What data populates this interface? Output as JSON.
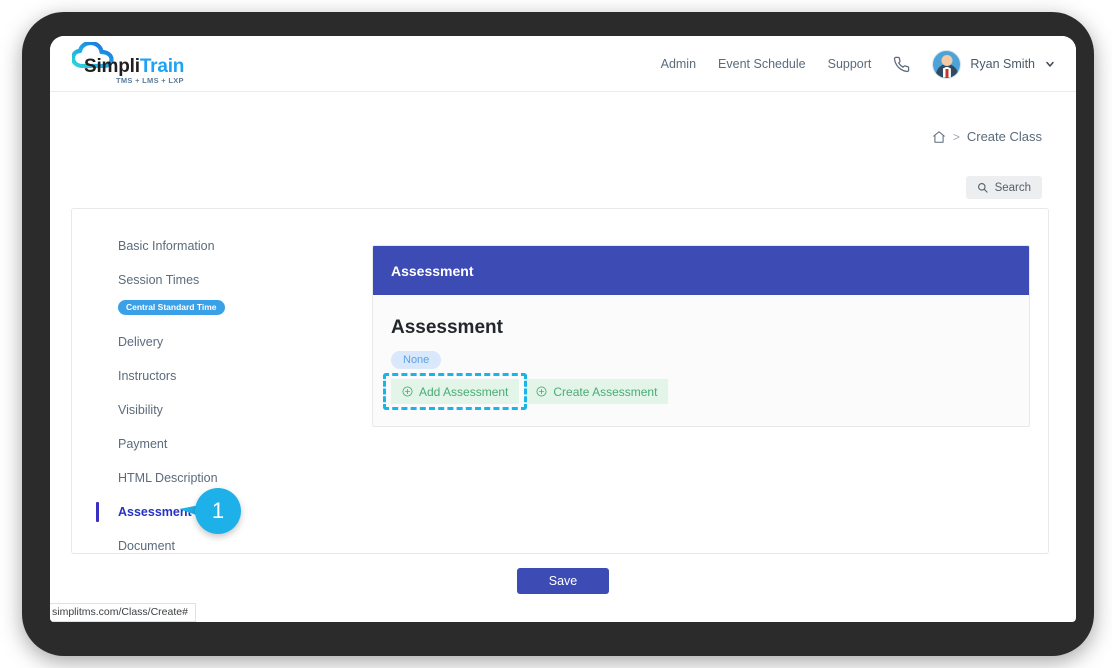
{
  "brand": {
    "simpli": "Simpli",
    "train": "Train",
    "tagline": "TMS + LMS + LXP",
    "logo_cyan": "#2fd6d6",
    "logo_blue": "#1e7fe0",
    "train_color": "#1ea2f3"
  },
  "navbar": {
    "links": [
      {
        "label": "Admin",
        "name": "nav-link-admin"
      },
      {
        "label": "Event Schedule",
        "name": "nav-link-event-schedule"
      },
      {
        "label": "Support",
        "name": "nav-link-support"
      }
    ],
    "phone_icon": "phone-icon",
    "avatar_icon": "user-avatar",
    "user_name": "Ryan Smith",
    "chevron_icon": "chevron-down-icon"
  },
  "breadcrumb": {
    "home_icon": "home-icon",
    "separator": ">",
    "current": "Create Class"
  },
  "search": {
    "icon": "search-icon",
    "label": "Search"
  },
  "sidebar": {
    "items": [
      {
        "label": "Basic Information",
        "active": false
      },
      {
        "label": "Session Times",
        "active": false,
        "badge": "Central Standard Time"
      },
      {
        "label": "Delivery",
        "active": false
      },
      {
        "label": "Instructors",
        "active": false
      },
      {
        "label": "Visibility",
        "active": false
      },
      {
        "label": "Payment",
        "active": false
      },
      {
        "label": "HTML Description",
        "active": false
      },
      {
        "label": "Assessment",
        "active": true
      },
      {
        "label": "Document",
        "active": false
      }
    ]
  },
  "callout": {
    "number": "1",
    "color": "#1eb0e8"
  },
  "panel": {
    "header_title": "Assessment",
    "header_color": "#3d4bb5",
    "heading": "Assessment",
    "status_badge": "None",
    "buttons": [
      {
        "label": "Add Assessment",
        "icon": "plus-circle-icon",
        "highlighted": true
      },
      {
        "label": "Create Assessment",
        "icon": "plus-circle-icon",
        "highlighted": false
      }
    ],
    "highlight_color": "#19b4ea",
    "button_bg": "#e3f5e9",
    "button_text_color": "#4aab75"
  },
  "footer": {
    "save_label": "Save"
  },
  "status_bar": {
    "url": "simplitms.com/Class/Create#"
  }
}
